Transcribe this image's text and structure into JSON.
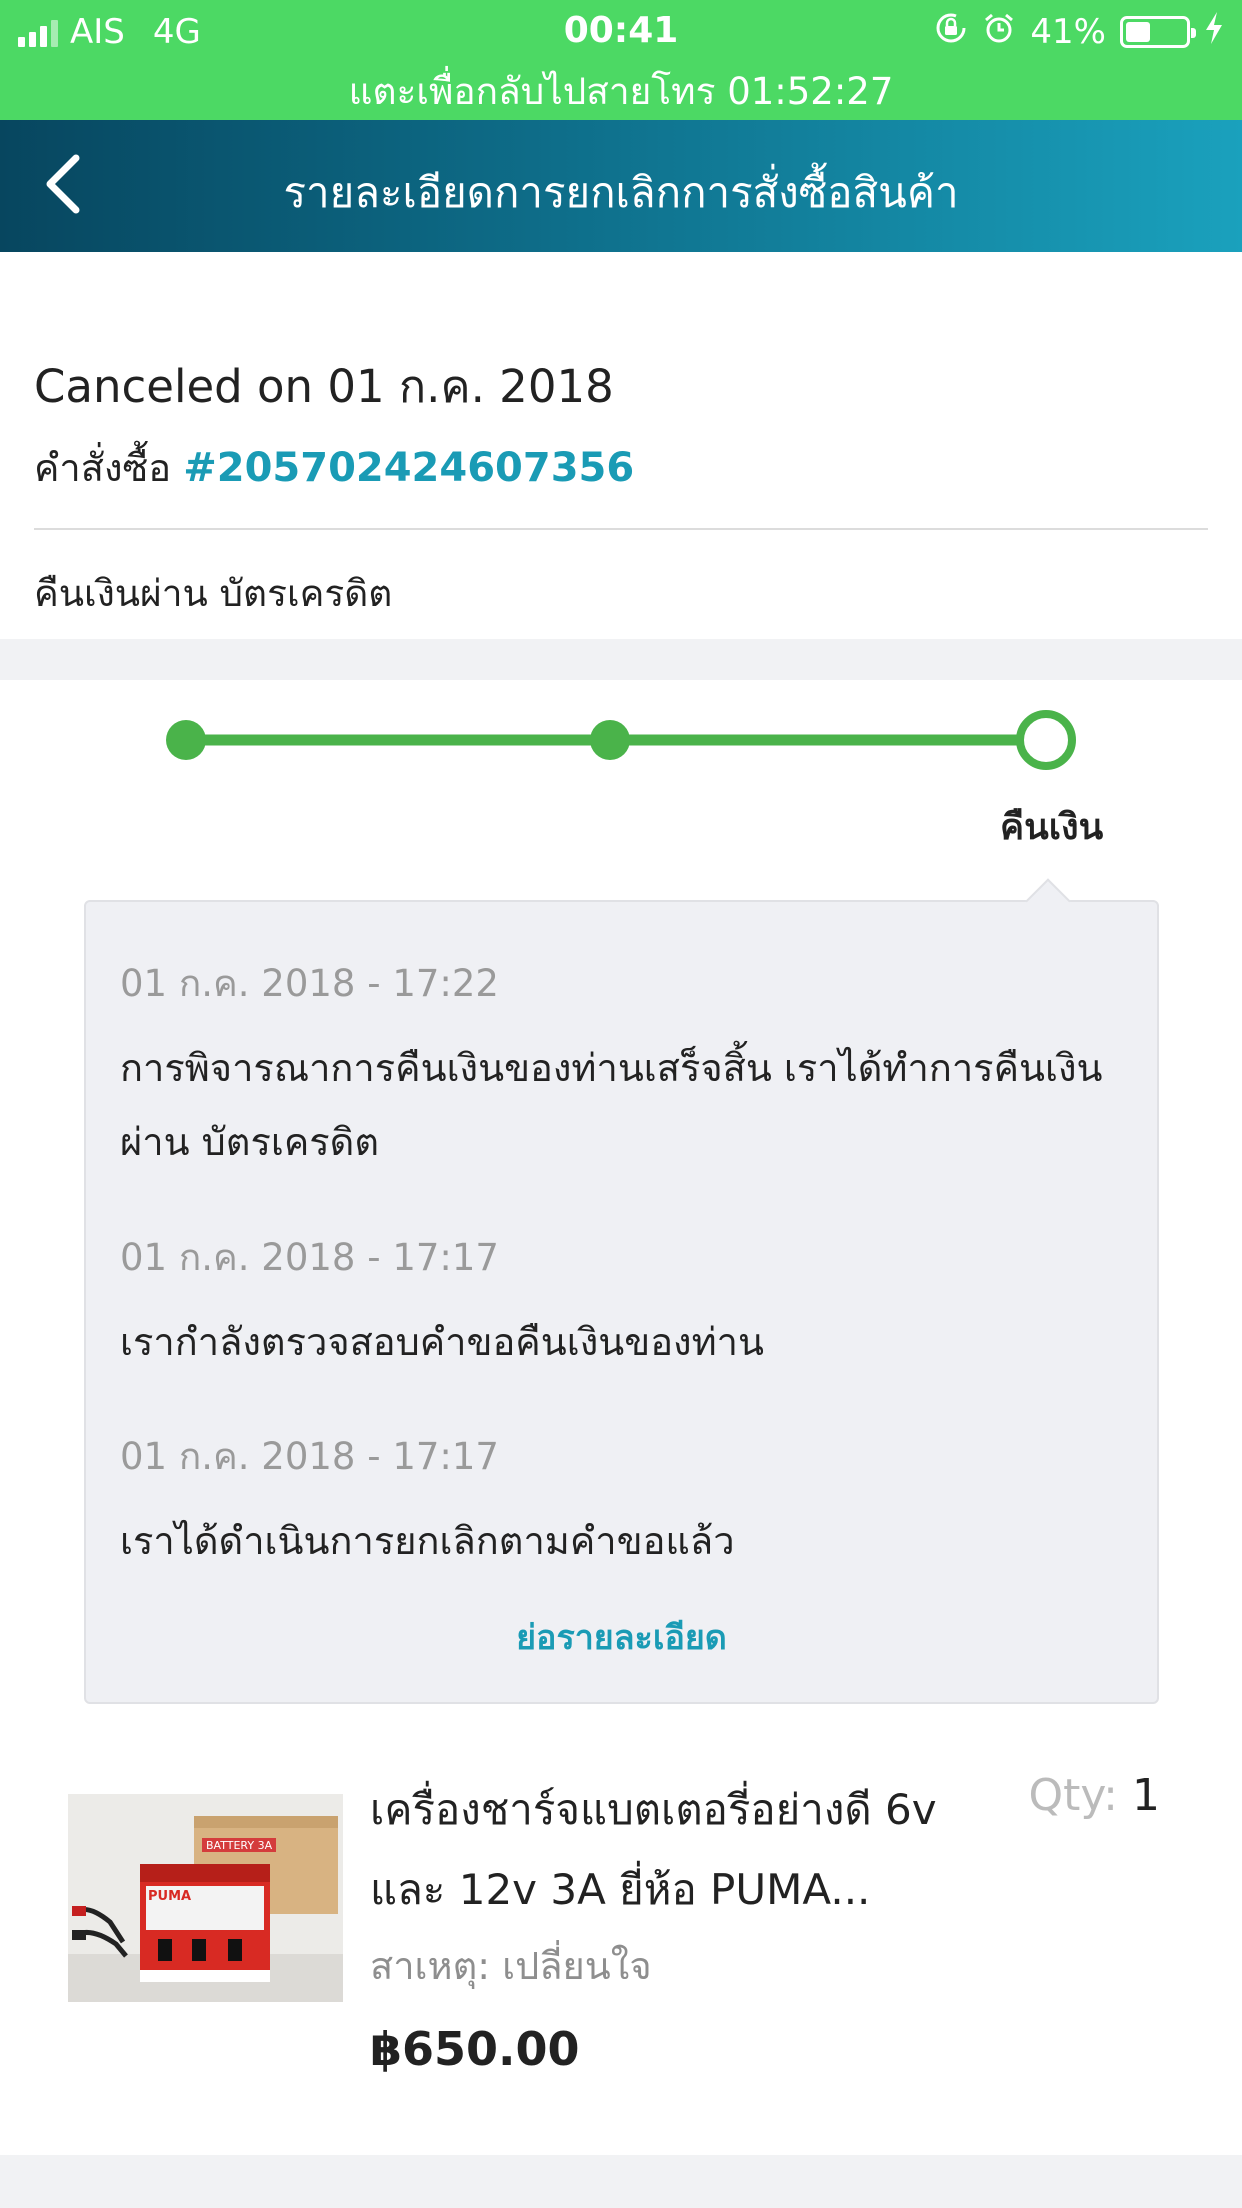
{
  "status_bar": {
    "carrier": "AIS",
    "network": "4G",
    "time": "00:41",
    "battery_percent": "41%",
    "battery_level": 0.41,
    "call_banner": "แตะเพื่อกลับไปสายโทร 01:52:27",
    "icons": [
      "signal-icon",
      "rotation-lock-icon",
      "alarm-icon",
      "battery-icon",
      "charging-icon"
    ],
    "bg_color": "#4cd964"
  },
  "header": {
    "title": "รายละเอียดการยกเลิกการสั่งซื้อสินค้า",
    "back_icon": "chevron-left-icon"
  },
  "summary": {
    "canceled_text": "Canceled on 01 ก.ค. 2018",
    "order_label": "คำสั่งซื้อ",
    "order_number": "#205702424607356",
    "refund_method": "คืนเงินผ่าน บัตรเครดิต"
  },
  "progress": {
    "steps_total": 3,
    "steps_completed": 3,
    "active_label": "คืนเงิน",
    "color": "#4ab34a"
  },
  "timeline": {
    "events": [
      {
        "date": "01 ก.ค. 2018 - 17:22",
        "text": "การพิจารณาการคืนเงินของท่านเสร็จสิ้น เราได้ทำการคืนเงินผ่าน บัตรเครดิต"
      },
      {
        "date": "01 ก.ค. 2018 - 17:17",
        "text": "เรากำลังตรวจสอบคำขอคืนเงินของท่าน"
      },
      {
        "date": "01 ก.ค. 2018 - 17:17",
        "text": "เราได้ดำเนินการยกเลิกตามคำขอแล้ว"
      }
    ],
    "collapse_label": "ย่อรายละเอียด"
  },
  "product": {
    "name": "เครื่องชาร์จแบตเตอรี่อย่างดี 6v และ 12v 3A ยี่ห้อ PUMA...",
    "qty_label": "Qty:",
    "qty": "1",
    "reason": "สาเหตุ: เปลี่ยนใจ",
    "price": "฿650.00",
    "image_brand_text": "PUMA",
    "image_box_text": "BATTERY 3A"
  }
}
